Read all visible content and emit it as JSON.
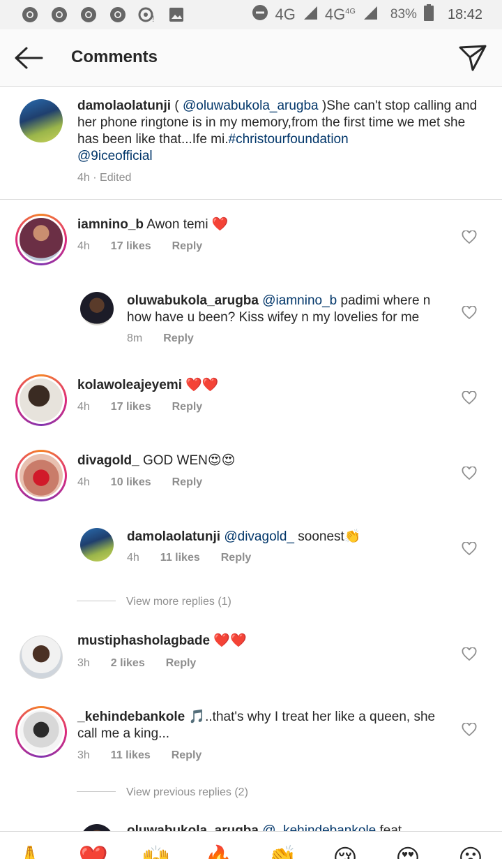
{
  "status_bar": {
    "network1": "4G",
    "network2": "4G",
    "network2_sup": "4G",
    "battery": "83%",
    "time": "18:42",
    "icons": [
      "chrome-icon",
      "chrome-icon",
      "chrome-icon",
      "chrome-icon",
      "sync-icon",
      "image-icon",
      "dnd-icon",
      "signal-icon",
      "signal-icon",
      "battery-icon"
    ]
  },
  "header": {
    "title": "Comments",
    "back_icon": "arrow-left-icon",
    "send_icon": "paper-plane-icon"
  },
  "caption": {
    "username": "damolaolatunji",
    "pre": " ( ",
    "mention": "@oluwabukola_arugba",
    "text1": " )She can't stop calling and her phone ringtone is in my memory,from the first time we met she has been like that...Ife mi.",
    "hashtag": "#christourfoundation",
    "mention2": "@9iceofficial",
    "meta": "4h · Edited"
  },
  "comments": [
    {
      "username": "iamnino_b",
      "text": " Awon temi ❤️",
      "time": "4h",
      "likes": "17 likes",
      "reply": "Reply"
    },
    {
      "username": "oluwabukola_arugba",
      "mention": "@iamnino_b",
      "text": " padimi where n how have u been? Kiss wifey n my lovelies for me",
      "time": "8m",
      "reply": "Reply"
    },
    {
      "username": "kolawoleajeyemi",
      "text": " ❤️❤️",
      "time": "4h",
      "likes": "17 likes",
      "reply": "Reply"
    },
    {
      "username": "divagold_",
      "text": " GOD WEN😍😍",
      "time": "4h",
      "likes": "10 likes",
      "reply": "Reply"
    },
    {
      "username": "damolaolatunji",
      "mention": "@divagold_",
      "text": " soonest👏",
      "time": "4h",
      "likes": "11 likes",
      "reply": "Reply"
    },
    {
      "username": "mustiphasholagbade",
      "text": " ❤️❤️",
      "time": "3h",
      "likes": "2 likes",
      "reply": "Reply"
    },
    {
      "username": "_kehindebankole",
      "text": " 🎵..that's why I treat her like a queen, she call me a king...",
      "time": "3h",
      "likes": "11 likes",
      "reply": "Reply"
    },
    {
      "username": "oluwabukola_arugba",
      "mention": "@_kehindebankole",
      "text": " feat"
    }
  ],
  "view_more_replies": "View more replies (1)",
  "view_previous_replies": "View previous replies (2)",
  "emoji_bar": [
    "🙏",
    "❤️",
    "🙌",
    "🔥",
    "👏",
    "😢",
    "😍",
    "😮"
  ]
}
